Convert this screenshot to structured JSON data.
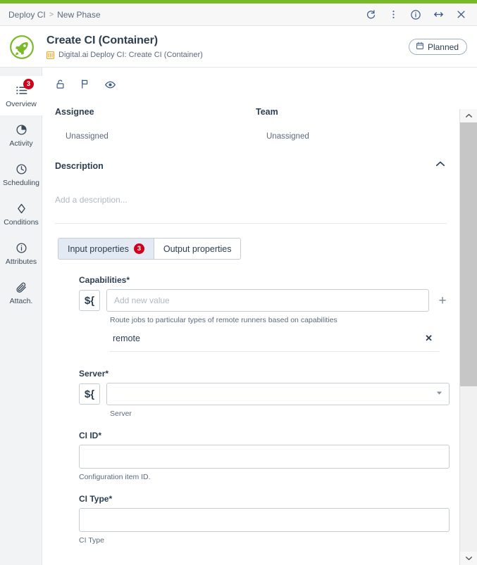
{
  "theme": {
    "accent_green": "#7ab929",
    "badge_red": "#d0021b",
    "icon_blue": "#3b5b8c",
    "text_dark": "#2c3e50",
    "text_muted": "#5b6a7d",
    "orange": "#f5a623"
  },
  "breadcrumb": {
    "root": "Deploy CI",
    "separator": ">",
    "current": "New Phase",
    "actions": [
      {
        "name": "refresh-icon",
        "label": "Refresh"
      },
      {
        "name": "more-options-icon",
        "label": "More options"
      },
      {
        "name": "info-icon",
        "label": "Info"
      },
      {
        "name": "expand-width-icon",
        "label": "Expand"
      },
      {
        "name": "close-icon",
        "label": "Close"
      }
    ]
  },
  "header": {
    "logo_icon": "rocket-icon",
    "title": "Create CI (Container)",
    "subtitle_icon": "task-type-icon",
    "subtitle": "Digital.ai Deploy CI: Create CI (Container)",
    "status": {
      "icon": "calendar-icon",
      "label": "Planned"
    }
  },
  "sidebar": {
    "items": [
      {
        "label": "Overview",
        "icon": "list-icon",
        "badge": "3",
        "active": true
      },
      {
        "label": "Activity",
        "icon": "pie-chart-icon",
        "badge": "",
        "active": false
      },
      {
        "label": "Scheduling",
        "icon": "clock-icon",
        "badge": "",
        "active": false
      },
      {
        "label": "Conditions",
        "icon": "diamond-icon",
        "badge": "",
        "active": false
      },
      {
        "label": "Attributes",
        "icon": "info-circle-icon",
        "badge": "",
        "active": false
      },
      {
        "label": "Attach.",
        "icon": "paperclip-icon",
        "badge": "",
        "active": false
      }
    ]
  },
  "toolbar": {
    "icons": [
      {
        "name": "lock-icon",
        "label": "Lock"
      },
      {
        "name": "flag-icon",
        "label": "Flag"
      },
      {
        "name": "eye-icon",
        "label": "Watch"
      }
    ]
  },
  "details": {
    "assignee_label": "Assignee",
    "assignee_value": "Unassigned",
    "team_label": "Team",
    "team_value": "Unassigned"
  },
  "description": {
    "heading": "Description",
    "collapse_icon": "chevron-up-icon",
    "placeholder": "Add a description..."
  },
  "tabs": [
    {
      "label": "Input properties",
      "badge": "3",
      "active": true
    },
    {
      "label": "Output properties",
      "badge": "",
      "active": false
    }
  ],
  "form": {
    "variable_button": "${",
    "fields": [
      {
        "label": "Capabilities",
        "required": "*",
        "placeholder": "Add new value",
        "value": "",
        "hint": "Route jobs to particular types of remote runners based on capabilities",
        "add_icon": "plus-icon",
        "chips": [
          {
            "text": "remote",
            "remove_icon": "close-icon"
          }
        ]
      },
      {
        "label": "Server",
        "required": "*",
        "placeholder": "",
        "value": "",
        "hint": "Server",
        "dropdown_icon": "chevron-down-icon"
      },
      {
        "label": "CI ID",
        "required": "*",
        "placeholder": "",
        "value": "",
        "hint": "Configuration item ID."
      },
      {
        "label": "CI Type",
        "required": "*",
        "placeholder": "",
        "value": "",
        "hint": "CI Type"
      }
    ]
  },
  "scrollbar": {
    "up_icon": "chevron-up-icon",
    "down_icon": "chevron-down-icon"
  }
}
